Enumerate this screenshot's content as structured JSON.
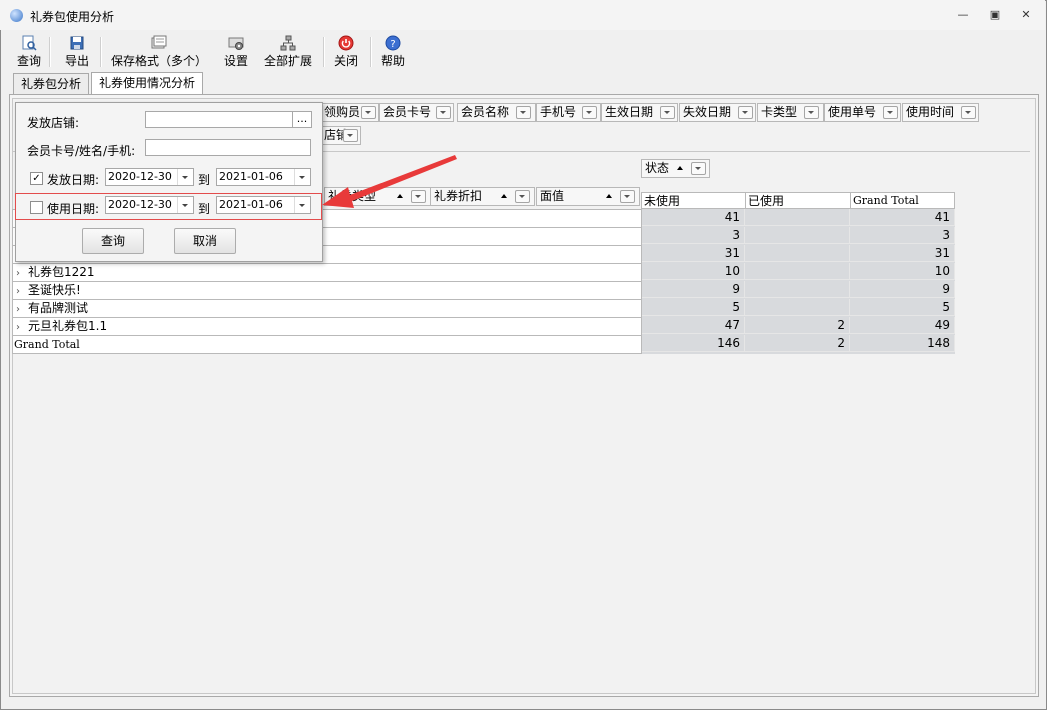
{
  "window": {
    "title": "礼券包使用分析",
    "controls": [
      "minimize-icon",
      "maximize-icon",
      "close-icon"
    ]
  },
  "toolbar": {
    "items": [
      {
        "label": "查询",
        "icon": "query-icon"
      },
      {
        "label": "导出",
        "icon": "export-icon"
      },
      {
        "label": "保存格式（多个）",
        "icon": "save-format-icon"
      },
      {
        "label": "设置",
        "icon": "settings-icon"
      },
      {
        "label": "全部扩展",
        "icon": "expand-all-icon"
      },
      {
        "label": "关闭",
        "icon": "close-power-icon"
      },
      {
        "label": "帮助",
        "icon": "help-icon"
      }
    ]
  },
  "tabs": [
    {
      "label": "礼券包分析",
      "active": false
    },
    {
      "label": "礼券使用情况分析",
      "active": true
    }
  ],
  "filter_fields": {
    "row1": [
      "领购员",
      "会员卡号",
      "会员名称",
      "手机号",
      "生效日期",
      "失效日期",
      "卡类型",
      "使用单号",
      "使用时间"
    ],
    "row2": [
      "店铺"
    ]
  },
  "column_field": "状态",
  "row_fields": [
    "礼券类型",
    "礼券折扣",
    "面值"
  ],
  "columns": [
    "未使用",
    "已使用",
    "Grand Total"
  ],
  "rows": [
    {
      "label": "",
      "values": [
        "41",
        "",
        "41"
      ]
    },
    {
      "label": "",
      "values": [
        "3",
        "",
        "3"
      ]
    },
    {
      "label": "",
      "values": [
        "31",
        "",
        "31"
      ]
    },
    {
      "label": "礼券包1221",
      "values": [
        "10",
        "",
        "10"
      ]
    },
    {
      "label": "圣诞快乐!",
      "values": [
        "9",
        "",
        "9"
      ]
    },
    {
      "label": "有品牌测试",
      "values": [
        "5",
        "",
        "5"
      ]
    },
    {
      "label": "元旦礼券包1.1",
      "values": [
        "47",
        "2",
        "49"
      ]
    }
  ],
  "grand_total": {
    "label": "Grand Total",
    "values": [
      "146",
      "2",
      "148"
    ]
  },
  "popup": {
    "store_label": "发放店铺:",
    "store_value": "",
    "store_btn": "...",
    "member_label": "会员卡号/姓名/手机:",
    "member_value": "",
    "issue_label": "发放日期:",
    "issue_checked": true,
    "issue_from": "2020-12-30",
    "issue_to": "2021-01-06",
    "use_label": "使用日期:",
    "use_checked": false,
    "use_from": "2020-12-30",
    "use_to": "2021-01-06",
    "to_label": "到",
    "query_button": "查询",
    "cancel_button": "取消"
  },
  "colors": {
    "highlight_border": "#e34c4c",
    "arrow": "#e83a3a",
    "value_cell_bg": "#d8dadd"
  }
}
